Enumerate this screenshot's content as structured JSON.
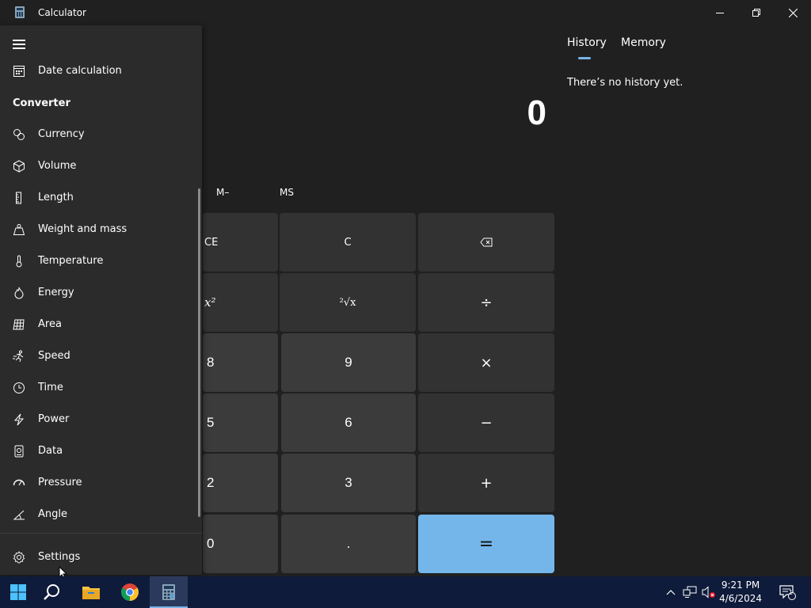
{
  "window": {
    "title": "Calculator",
    "controls": [
      "minimize",
      "restore",
      "close"
    ]
  },
  "display": {
    "value": "0"
  },
  "memory": {
    "buttons": [
      "M–",
      "MS"
    ]
  },
  "keypad": {
    "rows": [
      [
        "CE",
        "C",
        "⌫"
      ],
      [
        "x²",
        "²√x",
        "÷"
      ],
      [
        "8",
        "9",
        "×"
      ],
      [
        "5",
        "6",
        "−"
      ],
      [
        "2",
        "3",
        "+"
      ],
      [
        "0",
        ".",
        "="
      ]
    ]
  },
  "history_panel": {
    "tabs": [
      "History",
      "Memory"
    ],
    "active_tab": "History",
    "empty_message": "There’s no history yet."
  },
  "nav": {
    "top_item": {
      "label": "Date calculation",
      "icon": "calendar-icon"
    },
    "converter_heading": "Converter",
    "items": [
      {
        "label": "Currency",
        "icon": "currency-icon"
      },
      {
        "label": "Volume",
        "icon": "volume-cube-icon"
      },
      {
        "label": "Length",
        "icon": "ruler-icon"
      },
      {
        "label": "Weight and mass",
        "icon": "weight-icon"
      },
      {
        "label": "Temperature",
        "icon": "thermometer-icon"
      },
      {
        "label": "Energy",
        "icon": "flame-icon"
      },
      {
        "label": "Area",
        "icon": "area-grid-icon"
      },
      {
        "label": "Speed",
        "icon": "speed-runner-icon"
      },
      {
        "label": "Time",
        "icon": "clock-icon"
      },
      {
        "label": "Power",
        "icon": "lightning-icon"
      },
      {
        "label": "Data",
        "icon": "data-storage-icon"
      },
      {
        "label": "Pressure",
        "icon": "gauge-icon"
      },
      {
        "label": "Angle",
        "icon": "angle-icon"
      }
    ],
    "settings_label": "Settings"
  },
  "taskbar": {
    "time": "9:21 PM",
    "date": "4/6/2024",
    "notification_count": "1"
  },
  "colors": {
    "accent": "#75b6ea",
    "app_bg": "#202020",
    "drawer_bg": "#2b2b2b",
    "key_bg": "#3b3b3b",
    "taskbar_bg": "#0f1b3a"
  }
}
